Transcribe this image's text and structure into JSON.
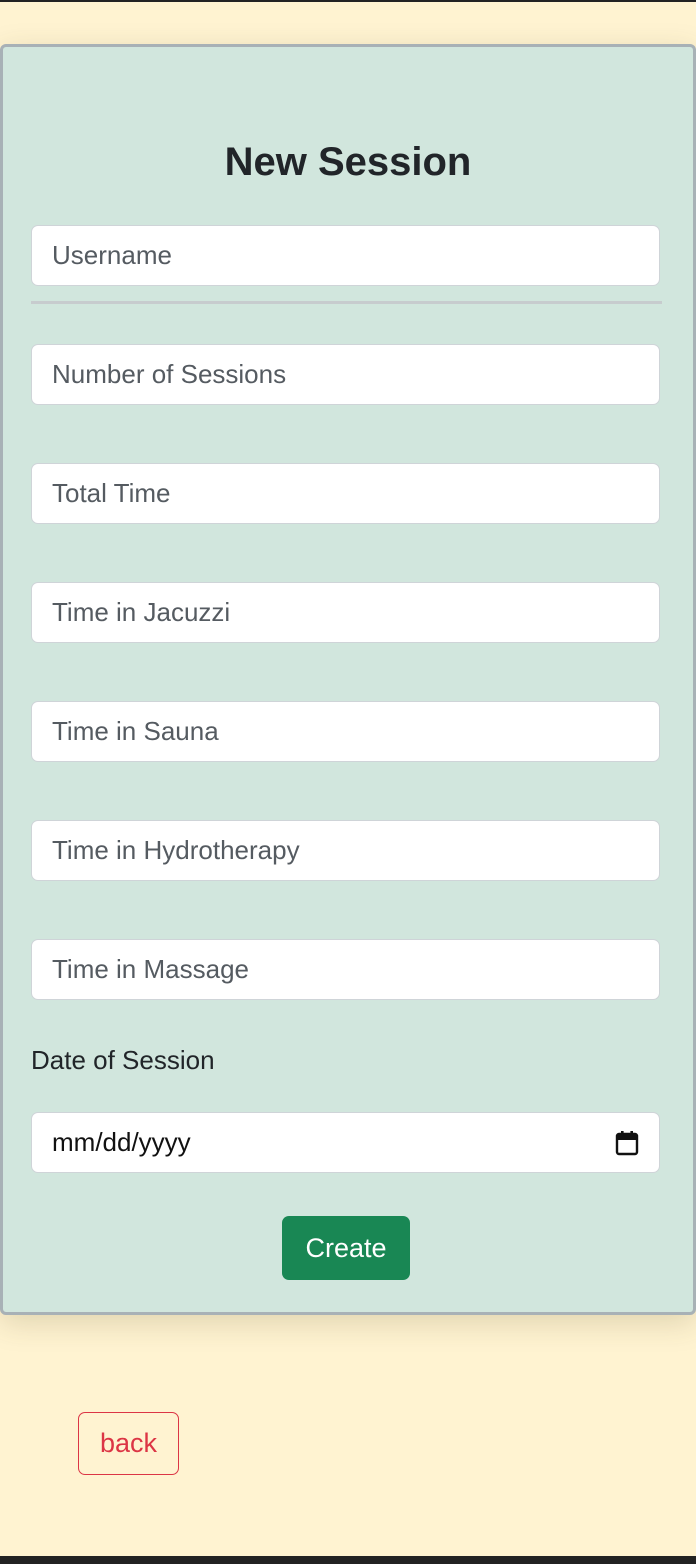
{
  "form": {
    "title": "New Session",
    "fields": [
      {
        "placeholder": "Username",
        "value": ""
      },
      {
        "placeholder": "Number of Sessions",
        "value": ""
      },
      {
        "placeholder": "Total Time",
        "value": ""
      },
      {
        "placeholder": "Time in Jacuzzi",
        "value": ""
      },
      {
        "placeholder": "Time in Sauna",
        "value": ""
      },
      {
        "placeholder": "Time in Hydrotherapy",
        "value": ""
      },
      {
        "placeholder": "Time in Massage",
        "value": ""
      }
    ],
    "date_label": "Date of Session",
    "date_placeholder": "mm/dd/yyyy",
    "submit_label": "Create"
  },
  "nav": {
    "back_label": "back"
  },
  "colors": {
    "page_background": "#fff3d1",
    "card_background": "#d1e6dd",
    "primary_button": "#198754",
    "back_button": "#dc3545"
  },
  "icons": {
    "date_picker": "calendar-icon"
  }
}
